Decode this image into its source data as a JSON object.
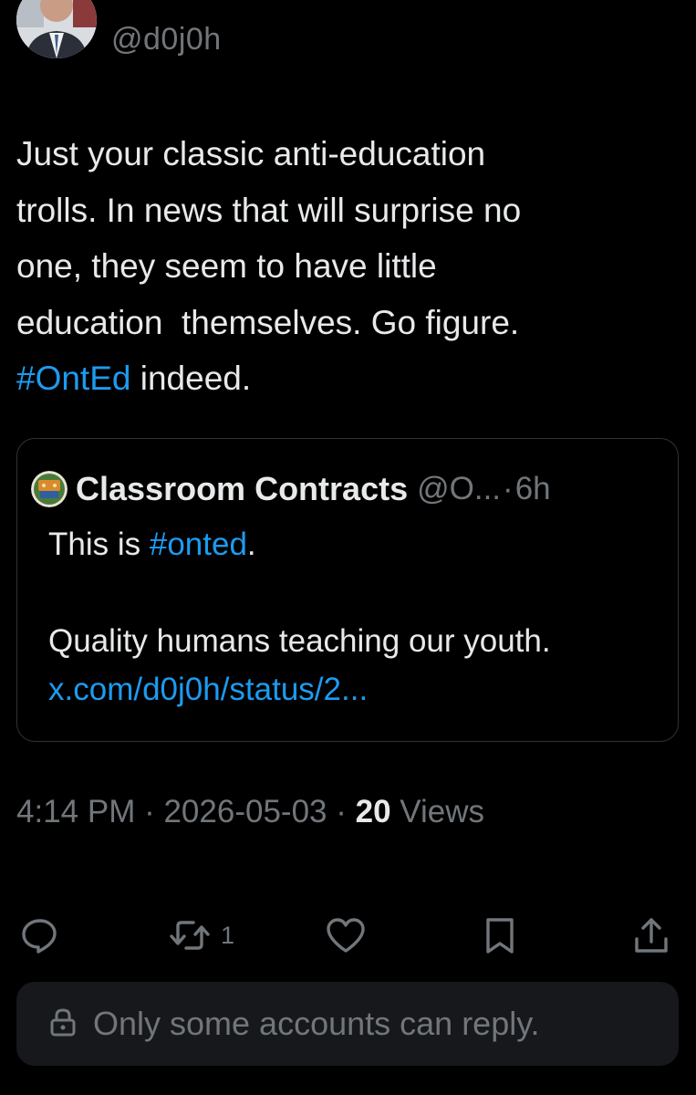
{
  "tweet": {
    "handle": "@d0j0h",
    "text": {
      "line1": "Just your classic anti-education",
      "line2": "trolls. In news that will surprise no",
      "line3": "one, they seem to have little",
      "line4": "education  themselves. Go figure.",
      "hashtag": "#OntEd",
      "line5_rest": " indeed."
    }
  },
  "quote": {
    "name": "Classroom Contracts",
    "handle": "@O...",
    "separator": "·",
    "time": "6h",
    "line1_prefix": "This is ",
    "line1_hashtag": "#onted",
    "line1_suffix": ".",
    "line2": "Quality humans teaching our youth.",
    "link": "x.com/d0j0h/status/2..."
  },
  "meta": {
    "time": "4:14 PM",
    "separator": " · ",
    "date": "2026-05-03",
    "views_count": "20",
    "views_label": " Views"
  },
  "actions": {
    "reply_icon": "reply-bubble-icon",
    "retweet_icon": "retweet-icon",
    "retweet_count": "1",
    "like_icon": "heart-icon",
    "bookmark_icon": "bookmark-icon",
    "share_icon": "share-icon"
  },
  "reply_restriction": {
    "icon": "lock-icon",
    "text": "Only some accounts can reply."
  },
  "colors": {
    "background": "#000000",
    "text": "#e7e9ea",
    "secondary": "#71767b",
    "accent": "#1d9bf0",
    "border": "#2f3336",
    "panel": "#16181c"
  }
}
